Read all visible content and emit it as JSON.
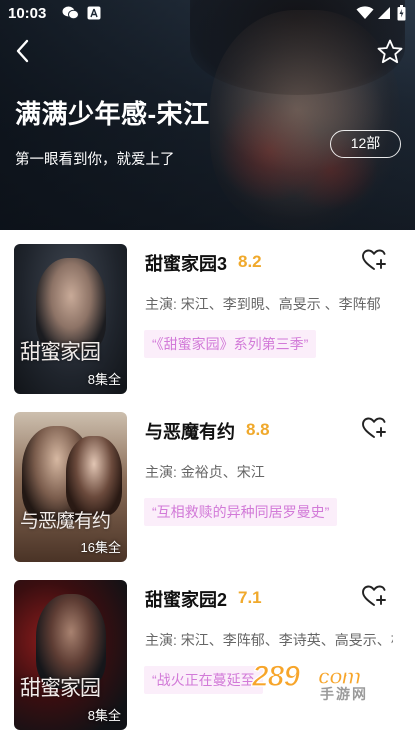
{
  "status_bar": {
    "time": "10:03",
    "icons": [
      "wechat-icon",
      "app-store-icon",
      "wifi-icon",
      "signal-icon",
      "battery-icon"
    ]
  },
  "header": {
    "title": "满满少年感-宋江",
    "subtitle": "第一眼看到你，就爱上了",
    "count_badge": "12部",
    "back_icon": "chevron-left-icon",
    "favorite_icon": "star-outline-icon"
  },
  "colors": {
    "score": "#f0a92c",
    "tag_bg": "#fbeefa",
    "tag_text": "#d27ad8",
    "cast_text": "#666666"
  },
  "dramas": [
    {
      "title": "甜蜜家园3",
      "score": "8.2",
      "cast": "主演: 宋江、李到晛、高旻示 、李阵郁",
      "tag": "“《甜蜜家园》系列第三季”",
      "poster_title": "甜蜜家园",
      "episodes": "8集全",
      "fav_icon": "heart-plus-icon"
    },
    {
      "title": "与恶魔有约",
      "score": "8.8",
      "cast": "主演: 金裕贞、宋江",
      "tag": "“互相救赎的异种同居罗曼史”",
      "poster_title": "与恶魔有约",
      "episodes": "16集全",
      "fav_icon": "heart-plus-icon"
    },
    {
      "title": "甜蜜家园2",
      "score": "7.1",
      "cast": "主演: 宋江、李阵郁、李诗英、高旻示、朴圭英",
      "tag": "“战火正在蔓延至",
      "poster_title": "甜蜜家园",
      "episodes": "8集全",
      "fav_icon": "heart-plus-icon"
    }
  ],
  "watermark": {
    "number": "289",
    "domain": "com",
    "name": "手游网"
  }
}
